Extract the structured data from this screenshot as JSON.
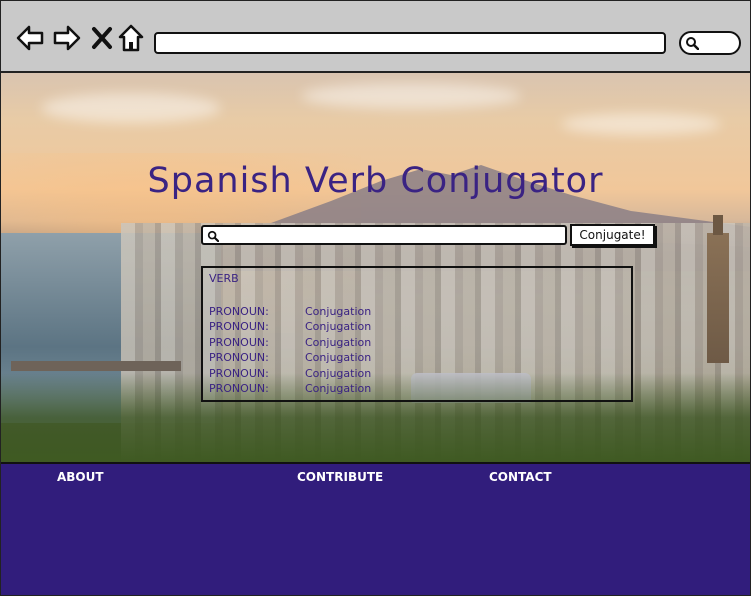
{
  "browser": {
    "icons": [
      "back-arrow-icon",
      "forward-arrow-icon",
      "close-x-icon",
      "home-icon",
      "search-icon"
    ],
    "url": ""
  },
  "hero": {
    "title": "Spanish Verb Conjugator",
    "search_value": "",
    "button_label": "Conjugate!"
  },
  "results": {
    "verb_label": "VERB",
    "rows": [
      {
        "pronoun": "PRONOUN:",
        "conjugation": "Conjugation"
      },
      {
        "pronoun": "PRONOUN:",
        "conjugation": "Conjugation"
      },
      {
        "pronoun": "PRONOUN:",
        "conjugation": "Conjugation"
      },
      {
        "pronoun": "PRONOUN:",
        "conjugation": "Conjugation"
      },
      {
        "pronoun": "PRONOUN:",
        "conjugation": "Conjugation"
      },
      {
        "pronoun": "PRONOUN:",
        "conjugation": "Conjugation"
      }
    ]
  },
  "footer": {
    "about": "ABOUT",
    "contribute": "CONTRIBUTE",
    "contact": "CONTACT"
  },
  "colors": {
    "accent": "#3a2383",
    "footer_bg": "#311d7c",
    "chrome_bg": "#c9c9c9"
  }
}
